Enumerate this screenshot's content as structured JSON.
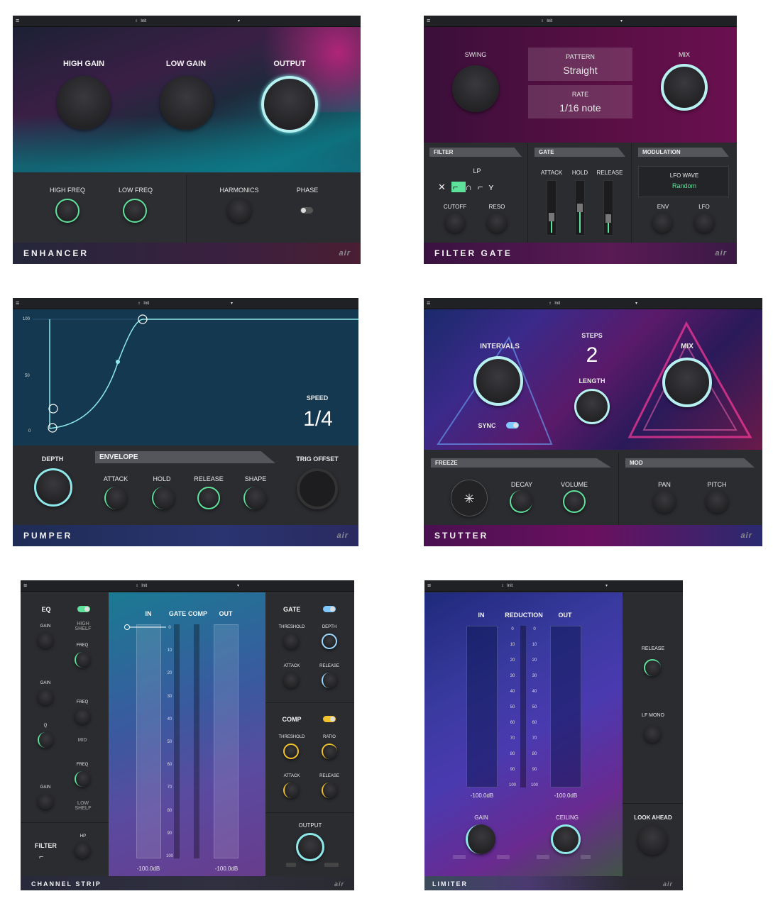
{
  "preset": "Init",
  "logo": "air",
  "enhancer": {
    "name": "ENHANCER",
    "knobs": {
      "high_gain": "HIGH GAIN",
      "low_gain": "LOW GAIN",
      "output": "OUTPUT"
    },
    "high_freq": "HIGH FREQ",
    "low_freq": "LOW FREQ",
    "harmonics": "HARMONICS",
    "phase": "PHASE"
  },
  "filter_gate": {
    "name": "FILTER GATE",
    "swing": "SWING",
    "mix": "MIX",
    "pattern_label": "PATTERN",
    "pattern_value": "Straight",
    "rate_label": "RATE",
    "rate_value": "1/16 note",
    "filter_tab": "FILTER",
    "gate_tab": "GATE",
    "mod_tab": "MODULATION",
    "filter_type": "LP",
    "cutoff": "CUTOFF",
    "reso": "RESO",
    "attack": "ATTACK",
    "hold": "HOLD",
    "release": "RELEASE",
    "lfo_wave_label": "LFO WAVE",
    "lfo_wave_value": "Random",
    "env": "ENV",
    "lfo": "LFO"
  },
  "pumper": {
    "name": "PUMPER",
    "y_ticks": [
      "100",
      "50",
      "0"
    ],
    "speed_label": "SPEED",
    "speed_value": "1/4",
    "depth": "DEPTH",
    "envelope_tab": "ENVELOPE",
    "attack": "ATTACK",
    "hold": "HOLD",
    "release": "RELEASE",
    "shape": "SHAPE",
    "trig_offset": "TRIG OFFSET"
  },
  "stutter": {
    "name": "STUTTER",
    "intervals": "INTERVALS",
    "steps_label": "STEPS",
    "steps_value": "2",
    "length": "LENGTH",
    "mix": "MIX",
    "sync": "SYNC",
    "freeze_tab": "FREEZE",
    "mod_tab": "MOD",
    "decay": "DECAY",
    "volume": "VOLUME",
    "pan": "PAN",
    "pitch": "PITCH"
  },
  "channel_strip": {
    "name": "CHANNEL STRIP",
    "eq": "EQ",
    "gain": "GAIN",
    "freq": "FREQ",
    "q": "Q",
    "high_shelf": "HIGH SHELF",
    "mid": "MID",
    "low_shelf": "LOW SHELF",
    "filter": "FILTER",
    "hp": "HP",
    "in": "IN",
    "gate_comp_gate": "GATE",
    "gate_comp_comp": "COMP",
    "out": "OUT",
    "scale": [
      "0",
      "10",
      "20",
      "30",
      "40",
      "50",
      "60",
      "70",
      "80",
      "90",
      "100"
    ],
    "in_value": "-100.0dB",
    "out_value": "-100.0dB",
    "gate": "GATE",
    "threshold": "THRESHOLD",
    "depth": "DEPTH",
    "attack": "ATTACK",
    "release": "RELEASE",
    "comp": "COMP",
    "ratio": "RATIO",
    "output": "OUTPUT"
  },
  "limiter": {
    "name": "LIMITER",
    "in": "IN",
    "reduction": "REDUCTION",
    "out": "OUT",
    "scale": [
      "0",
      "10",
      "20",
      "30",
      "40",
      "50",
      "60",
      "70",
      "80",
      "90",
      "100"
    ],
    "in_value": "-100.0dB",
    "out_value": "-100.0dB",
    "gain": "GAIN",
    "ceiling": "CEILING",
    "release": "RELEASE",
    "lf_mono": "LF MONO",
    "look_ahead": "LOOK AHEAD"
  }
}
